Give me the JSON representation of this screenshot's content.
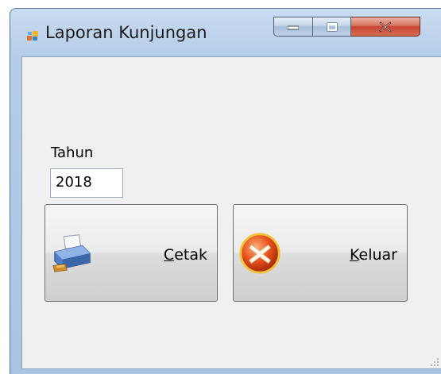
{
  "window": {
    "title": "Laporan Kunjungan",
    "icons": {
      "app": "form-icon",
      "minimize": "minimize-icon",
      "maximize": "maximize-icon",
      "close": "close-icon"
    },
    "colors": {
      "close_button": "#c74532",
      "client_bg": "#f0f0f0"
    }
  },
  "form": {
    "year_label": "Tahun",
    "year_value": "2018",
    "print_button": {
      "accel": "C",
      "rest": "etak",
      "icon": "printer-icon"
    },
    "exit_button": {
      "accel": "K",
      "rest": "eluar",
      "icon": "exit-icon"
    }
  }
}
